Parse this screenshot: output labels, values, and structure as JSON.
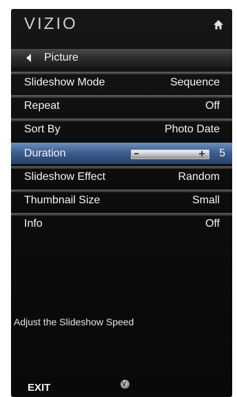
{
  "header": {
    "logo": "VIZIO",
    "home_icon": "home-icon"
  },
  "breadcrumb": {
    "label": "Picture",
    "icon": "back-arrow-icon"
  },
  "menu": {
    "items": [
      {
        "label": "Slideshow Mode",
        "value": "Sequence"
      },
      {
        "label": "Repeat",
        "value": "Off"
      },
      {
        "label": "Sort By",
        "value": "Photo Date"
      },
      {
        "label": "Duration",
        "value": "5",
        "selected": true
      },
      {
        "label": "Slideshow Effect",
        "value": "Random"
      },
      {
        "label": "Thumbnail Size",
        "value": "Small"
      },
      {
        "label": "Info",
        "value": "Off"
      }
    ]
  },
  "help_text": "Adjust the Slideshow Speed",
  "footer": {
    "exit_label": "EXIT",
    "v_button_icon": "v-button-icon",
    "v_button_glyph": "V"
  },
  "colors": {
    "selection": "#3e5f8f",
    "background": "#0b0b0b",
    "text": "#f4f4f4"
  }
}
